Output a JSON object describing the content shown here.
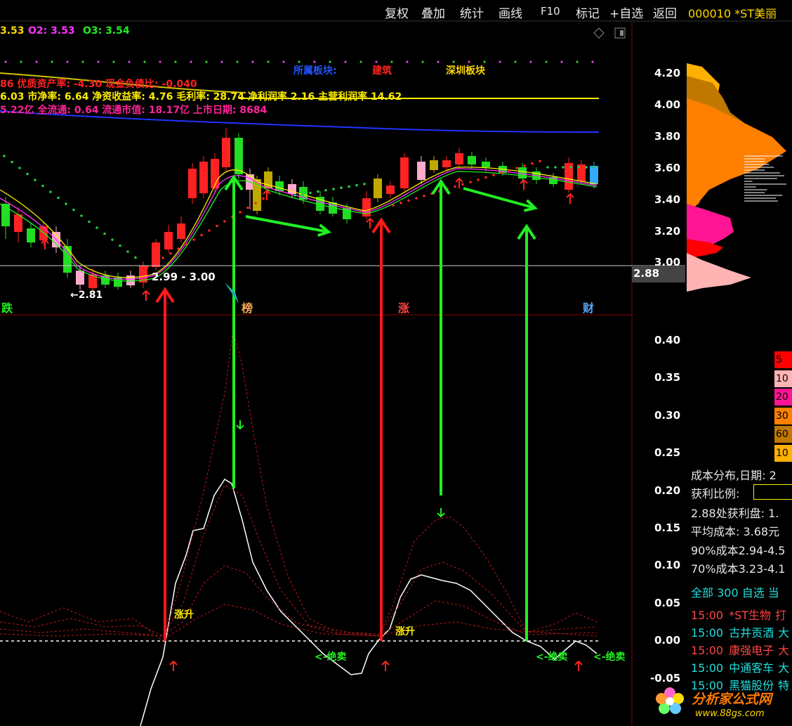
{
  "menu": {
    "items": [
      "复权",
      "叠加",
      "统计",
      "画线",
      "F10",
      "标记",
      "+自选",
      "返回"
    ],
    "stock": "000010 *ST美丽"
  },
  "ohlc_overlay": [
    {
      "label": "3.53",
      "color": "#ffd800"
    },
    {
      "label": "O2: 3.53",
      "color": "#ff33ff"
    },
    {
      "label": "O3: 3.54",
      "color": "#22ee22"
    }
  ],
  "sector_labels": {
    "a": "所属板块:",
    "b": "建筑",
    "c": "深圳板块"
  },
  "fund_lines": {
    "l1": "86 优质资产率: -4.30 现金负债比: -0.040",
    "l2": "6.03 市净率: 6.64 净资收益率: 4.76 毛利率: 28.74 净利润率 2.16 主营利润率 14.62",
    "l3": "5.22亿 全流通: 0.64 流通市值: 18.17亿 上市日期: 8684"
  },
  "price_axis": [
    "4.20",
    "4.00",
    "3.80",
    "3.60",
    "3.40",
    "3.20",
    "3.00"
  ],
  "price_current": "2.88",
  "candle_annot": {
    "range": "2.99 - 3.00",
    "low": "←2.81",
    "die": "跌",
    "bang": "榜",
    "zhang": "涨",
    "cai": "财"
  },
  "indicator_axis": [
    "0.40",
    "0.35",
    "0.30",
    "0.25",
    "0.20",
    "0.15",
    "0.10",
    "0.05",
    "0.00",
    "-0.05"
  ],
  "signals": {
    "rise": "涨升",
    "sell1": "<-绝卖",
    "sell2": "<-绝卖",
    "sell3": "<-绝卖"
  },
  "cost_legend": [
    {
      "label": "5",
      "color": "#ff0000"
    },
    {
      "label": "10",
      "color": "#ffb3b3"
    },
    {
      "label": "20",
      "color": "#ff1493"
    },
    {
      "label": "30",
      "color": "#ff7f00"
    },
    {
      "label": "60",
      "color": "#c07800"
    },
    {
      "label": "10",
      "color": "#ffb000"
    }
  ],
  "cost_info": {
    "date": "成本分布,日期: 2",
    "profit_label": "获利比例:",
    "profit_at": "2.88处获利盘: 1.",
    "avg": "平均成本: 3.68元",
    "c90": "90%成本2.94-4.5",
    "c70": "70%成本3.23-4.1"
  },
  "list_header": "全部 300 自选 当",
  "list_rows": [
    {
      "time": "15:00",
      "name": "*ST生物",
      "extra": "打",
      "color": "#ff4444"
    },
    {
      "time": "15:00",
      "name": "古井贡酒",
      "extra": "大",
      "color": "#22dddd"
    },
    {
      "time": "15:00",
      "name": "康强电子",
      "extra": "大",
      "color": "#ff4444"
    },
    {
      "time": "15:00",
      "name": "中通客车",
      "extra": "大",
      "color": "#22dddd"
    },
    {
      "time": "15:00",
      "name": "黑猫股份",
      "extra": "特",
      "color": "#22dddd"
    }
  ],
  "watermark": {
    "text": "分析家公式网",
    "url": "www.88gs.com"
  }
}
